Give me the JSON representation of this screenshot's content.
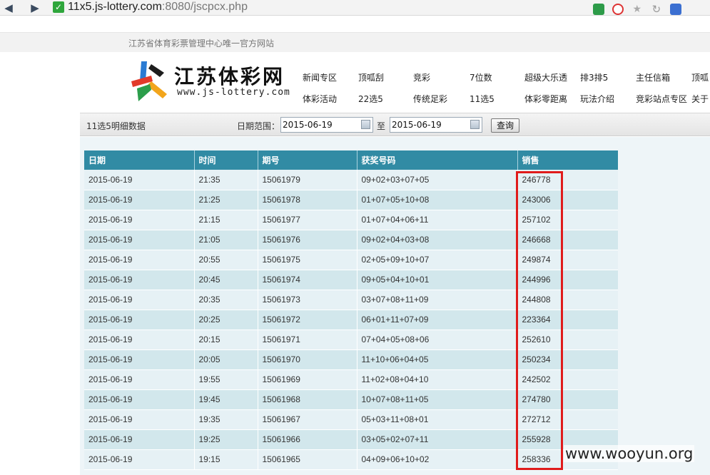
{
  "browser": {
    "url_host": "11x5.js-lottery.com",
    "url_rest": ":8080/jscpcx.php"
  },
  "site": {
    "strip_text": "江苏省体育彩票管理中心唯一官方网站",
    "logo_title": "江苏体彩网",
    "logo_url": "www.js-lottery.com"
  },
  "nav": {
    "row1": [
      "新闻专区",
      "顶呱刮",
      "竞彩",
      "7位数",
      "超级大乐透",
      "排3排5",
      "主任信箱",
      "顶呱"
    ],
    "row2": [
      "体彩活动",
      "22选5",
      "传统足彩",
      "11选5",
      "体彩零距离",
      "玩法介绍",
      "竞彩站点专区",
      "关于"
    ]
  },
  "query": {
    "title": "11选5明细数据",
    "range_label": "日期范围：",
    "from": "2015-06-19",
    "separator": "至",
    "to": "2015-06-19",
    "button": "查询"
  },
  "table": {
    "headers": [
      "日期",
      "时间",
      "期号",
      "获奖号码",
      "销售"
    ],
    "rows": [
      [
        "2015-06-19",
        "21:35",
        "15061979",
        "09+02+03+07+05",
        "246778"
      ],
      [
        "2015-06-19",
        "21:25",
        "15061978",
        "01+07+05+10+08",
        "243006"
      ],
      [
        "2015-06-19",
        "21:15",
        "15061977",
        "01+07+04+06+11",
        "257102"
      ],
      [
        "2015-06-19",
        "21:05",
        "15061976",
        "09+02+04+03+08",
        "246668"
      ],
      [
        "2015-06-19",
        "20:55",
        "15061975",
        "02+05+09+10+07",
        "249874"
      ],
      [
        "2015-06-19",
        "20:45",
        "15061974",
        "09+05+04+10+01",
        "244996"
      ],
      [
        "2015-06-19",
        "20:35",
        "15061973",
        "03+07+08+11+09",
        "244808"
      ],
      [
        "2015-06-19",
        "20:25",
        "15061972",
        "06+01+11+07+09",
        "223364"
      ],
      [
        "2015-06-19",
        "20:15",
        "15061971",
        "07+04+05+08+06",
        "252610"
      ],
      [
        "2015-06-19",
        "20:05",
        "15061970",
        "11+10+06+04+05",
        "250234"
      ],
      [
        "2015-06-19",
        "19:55",
        "15061969",
        "11+02+08+04+10",
        "242502"
      ],
      [
        "2015-06-19",
        "19:45",
        "15061968",
        "10+07+08+11+05",
        "274780"
      ],
      [
        "2015-06-19",
        "19:35",
        "15061967",
        "05+03+11+08+01",
        "272712"
      ],
      [
        "2015-06-19",
        "19:25",
        "15061966",
        "03+05+02+07+11",
        "255928"
      ],
      [
        "2015-06-19",
        "19:15",
        "15061965",
        "04+09+06+10+02",
        "258336"
      ]
    ]
  },
  "watermark": "www.wooyun.org"
}
